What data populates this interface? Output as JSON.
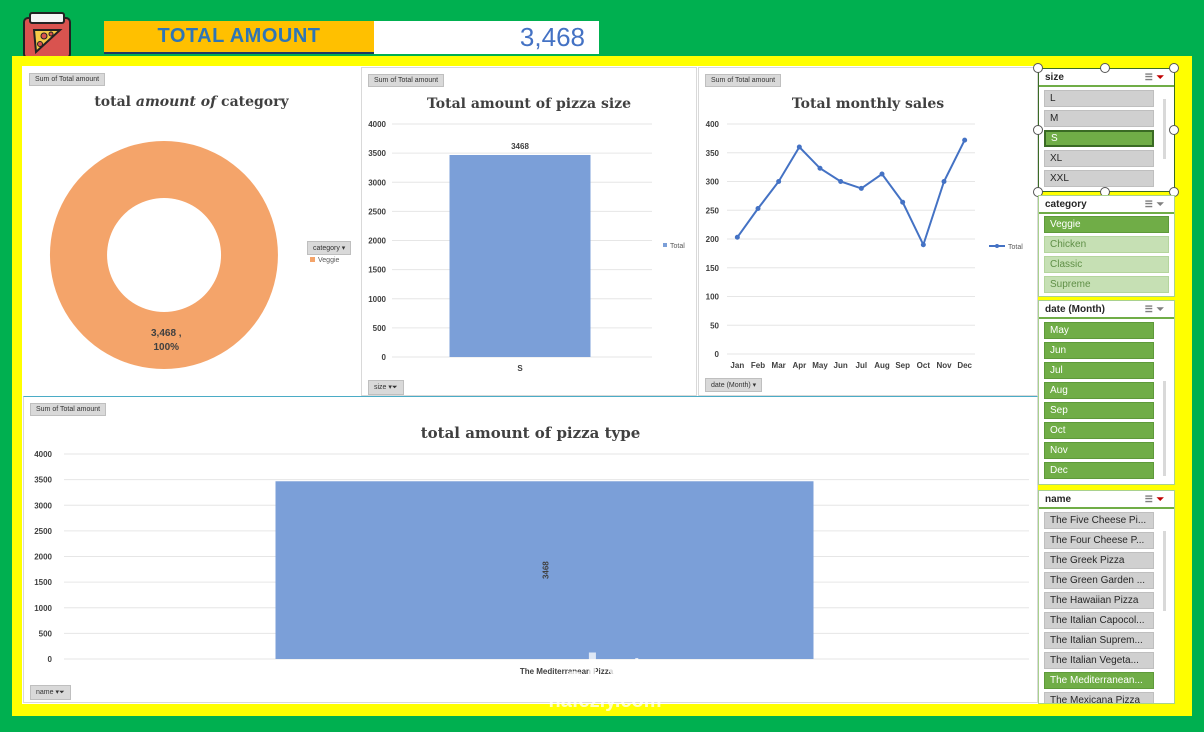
{
  "header": {
    "total_label": "TOTAL AMOUNT",
    "total_value": "3,468"
  },
  "colors": {
    "background": "#00b050",
    "frame": "#ffff00",
    "label_bg": "#ffc000",
    "bar_blue": "#7b9fd8",
    "donut_orange": "#f4a46a",
    "slicer_green": "#70ad47"
  },
  "donut_panel": {
    "pill": "Sum of Total amount",
    "title_pre": "total ",
    "title_em": "amount of",
    "title_post": " category",
    "legend_filter": "category",
    "legend_item": "Veggie",
    "data_label_value": "3,468 ,",
    "data_label_pct": "100%"
  },
  "size_panel": {
    "pill": "Sum of Total amount",
    "title": "Total amount of pizza size",
    "legend": "Total",
    "filter_pill": "size"
  },
  "monthly_panel": {
    "pill": "Sum of Total amount",
    "title": "Total monthly sales",
    "legend": "Total",
    "filter_pill": "date (Month)"
  },
  "type_panel": {
    "pill": "Sum of Total amount",
    "title": "total amount of pizza type",
    "filter_pill": "name"
  },
  "chart_data": [
    {
      "type": "pie",
      "title": "total amount of category",
      "categories": [
        "Veggie"
      ],
      "values": [
        3468
      ],
      "percent": [
        100
      ],
      "donut": true
    },
    {
      "type": "bar",
      "title": "Total amount of pizza size",
      "categories": [
        "S"
      ],
      "values": [
        3468
      ],
      "series": [
        {
          "name": "Total",
          "values": [
            3468
          ]
        }
      ],
      "ylim": [
        0,
        4000
      ],
      "yticks": [
        0,
        500,
        1000,
        1500,
        2000,
        2500,
        3000,
        3500,
        4000
      ],
      "data_labels": [
        "3468"
      ],
      "grid": true
    },
    {
      "type": "line",
      "title": "Total monthly sales",
      "categories": [
        "Jan",
        "Feb",
        "Mar",
        "Apr",
        "May",
        "Jun",
        "Jul",
        "Aug",
        "Sep",
        "Oct",
        "Nov",
        "Dec"
      ],
      "values": [
        203,
        253,
        300,
        360,
        323,
        300,
        288,
        313,
        264,
        190,
        300,
        372
      ],
      "series": [
        {
          "name": "Total",
          "values": [
            203,
            253,
            300,
            360,
            323,
            300,
            288,
            313,
            264,
            190,
            300,
            372
          ]
        }
      ],
      "ylim": [
        0,
        400
      ],
      "yticks": [
        0,
        50,
        100,
        150,
        200,
        250,
        300,
        350,
        400
      ],
      "grid": true,
      "legend": "right"
    },
    {
      "type": "bar",
      "title": "total amount of pizza type",
      "categories": [
        "The Mediterranean Pizza"
      ],
      "values": [
        3468
      ],
      "ylim": [
        0,
        4000
      ],
      "yticks": [
        0,
        500,
        1000,
        1500,
        2000,
        2500,
        3000,
        3500,
        4000
      ],
      "data_labels": [
        "3468"
      ],
      "grid": true
    }
  ],
  "slicers": {
    "size": {
      "title": "size",
      "items": [
        "L",
        "M",
        "S",
        "XL",
        "XXL"
      ],
      "selected": "S"
    },
    "category": {
      "title": "category",
      "items": [
        "Veggie",
        "Chicken",
        "Classic",
        "Supreme"
      ],
      "selected": "Veggie"
    },
    "month": {
      "title": "date (Month)",
      "items": [
        "May",
        "Jun",
        "Jul",
        "Aug",
        "Sep",
        "Oct",
        "Nov",
        "Dec"
      ]
    },
    "name": {
      "title": "name",
      "items": [
        "The Five Cheese Pi...",
        "The Four Cheese P...",
        "The Greek Pizza",
        "The Green Garden ...",
        "The Hawaiian Pizza",
        "The Italian Capocol...",
        "The Italian Suprem...",
        "The Italian Vegeta...",
        "The Mediterranean...",
        "The Mexicana Pizza"
      ],
      "selected": "The Mediterranean..."
    }
  },
  "watermark": {
    "arabic": "نفذلي",
    "latin": "nafezly.com"
  }
}
